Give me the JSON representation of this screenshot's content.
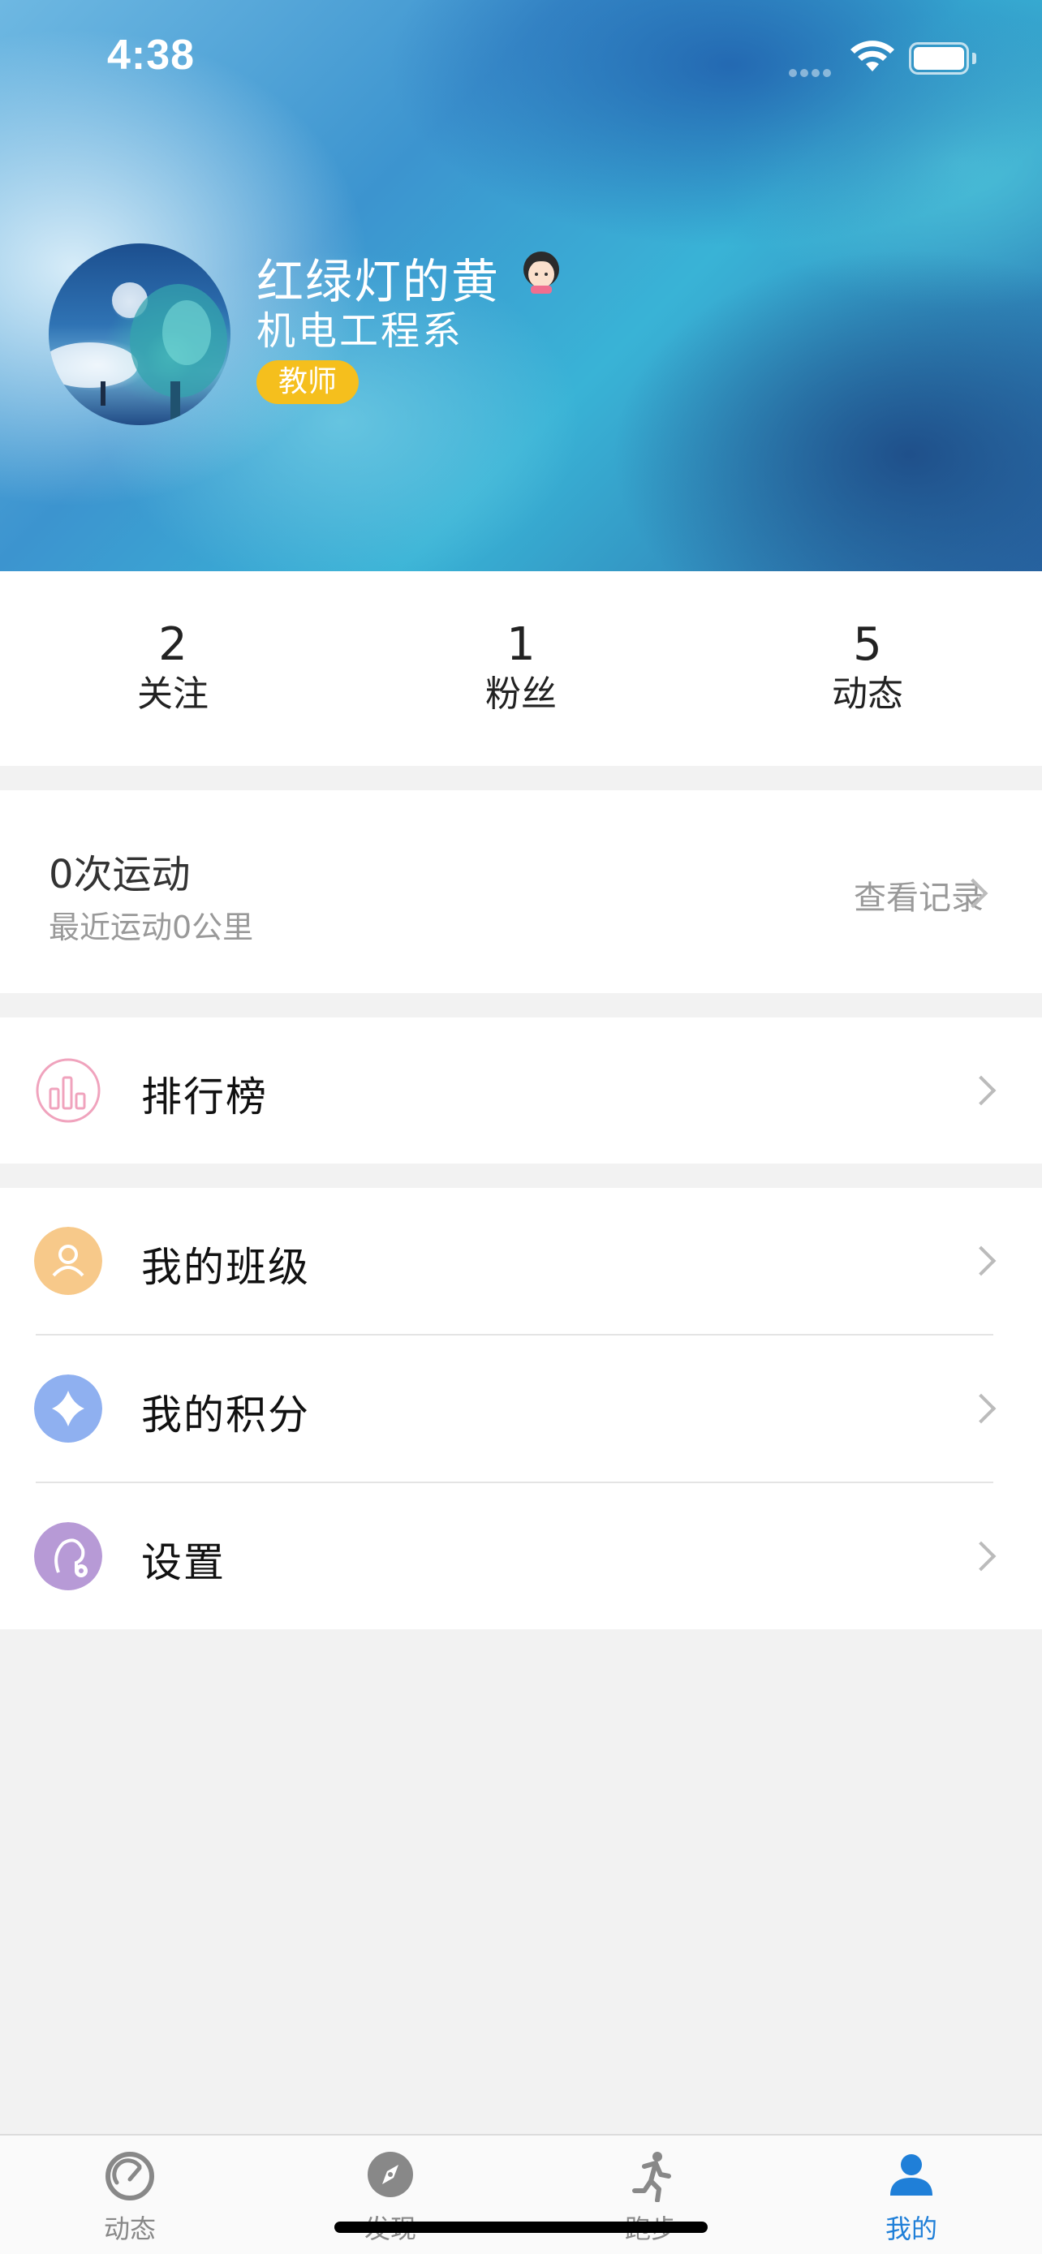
{
  "status_bar": {
    "time": "4:38"
  },
  "profile": {
    "name": "红绿灯的黄",
    "department": "机电工程系",
    "role": "教师"
  },
  "stats": [
    {
      "value": "2",
      "label": "关注"
    },
    {
      "value": "1",
      "label": "粉丝"
    },
    {
      "value": "5",
      "label": "动态"
    }
  ],
  "exercise": {
    "count": "0次运动",
    "recent": "最近运动0公里",
    "view_records": "查看记录"
  },
  "menu": {
    "leaderboard": "排行榜",
    "my_class": "我的班级",
    "my_points": "我的积分",
    "settings": "设置"
  },
  "tabbar": {
    "tabs": [
      {
        "label": "动态",
        "icon": "speedometer-icon"
      },
      {
        "label": "发现",
        "icon": "compass-icon"
      },
      {
        "label": "跑步",
        "icon": "runner-icon"
      },
      {
        "label": "我的",
        "icon": "person-icon"
      }
    ],
    "active": "我的"
  },
  "colors": {
    "accent": "#1f7fd8",
    "badge": "#f5bf1d",
    "leaderboard_icon": "#f0a3bd",
    "class_icon": "#f7c98a",
    "points_icon": "#8fb0f0",
    "settings_icon": "#b79ad6"
  }
}
